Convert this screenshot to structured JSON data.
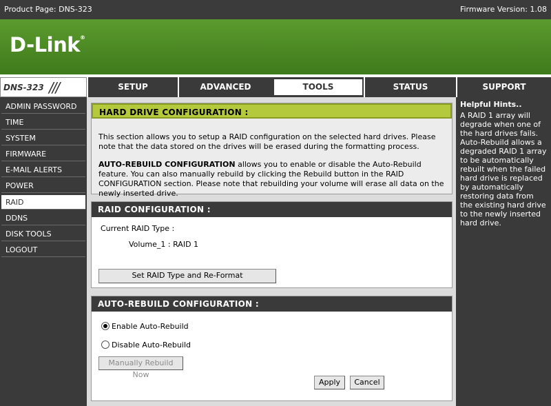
{
  "topbar": {
    "product_page": "Product Page: DNS-323",
    "firmware": "Firmware Version: 1.08"
  },
  "banner": {
    "logo": "D-Link",
    "logo_mark": "®"
  },
  "model": {
    "name": "DNS-323",
    "slashes": "///"
  },
  "tabs": [
    {
      "label": "SETUP",
      "active": false
    },
    {
      "label": "ADVANCED",
      "active": false
    },
    {
      "label": "TOOLS",
      "active": true
    },
    {
      "label": "STATUS",
      "active": false
    },
    {
      "label": "SUPPORT",
      "active": false
    }
  ],
  "sidebar": {
    "items": [
      {
        "label": "ADMIN PASSWORD"
      },
      {
        "label": "TIME"
      },
      {
        "label": "SYSTEM"
      },
      {
        "label": "FIRMWARE"
      },
      {
        "label": "E-MAIL ALERTS"
      },
      {
        "label": "POWER MANAGEMENT"
      },
      {
        "label": "RAID",
        "active": true
      },
      {
        "label": "DDNS"
      },
      {
        "label": "DISK TOOLS"
      },
      {
        "label": "LOGOUT"
      }
    ]
  },
  "hard_drive": {
    "heading": "HARD DRIVE CONFIGURATION :",
    "para1": "This section allows you to setup a RAID configuration on the selected hard drives. Please note that the data stored on the drives will be erased during the formatting process.",
    "para2_bold": "AUTO-REBUILD CONFIGURATION",
    "para2_rest": " allows you to enable or disable the Auto-Rebuild feature. You can also manually rebuild by clicking the Rebuild button in the RAID CONFIGURATION section. Please note that rebuilding your volume will erase all data on the newly inserted drive."
  },
  "raid": {
    "heading": "RAID CONFIGURATION :",
    "current_type_label": "Current RAID Type :",
    "volume": "Volume_1 : RAID 1",
    "set_button": "Set RAID Type and Re-Format"
  },
  "auto_rebuild": {
    "heading": "AUTO-REBUILD CONFIGURATION :",
    "enable_label": "Enable Auto-Rebuild",
    "disable_label": "Disable Auto-Rebuild",
    "enabled": true,
    "manual_button": "Manually Rebuild Now",
    "apply_button": "Apply",
    "cancel_button": "Cancel"
  },
  "hints": {
    "title": "Helpful Hints..",
    "body": "A RAID 1 array will degrade when one of the hard drives fails. Auto-Rebuild allows a degraded RAID 1 array to be automatically rebuilt when the failed hard drive is replaced by automatically restoring data from the existing hard drive to the newly inserted hard drive."
  },
  "colors": {
    "banner_green": "#4d8724",
    "header_green": "#b4c93c",
    "dark_gray": "#3a3a3a"
  }
}
